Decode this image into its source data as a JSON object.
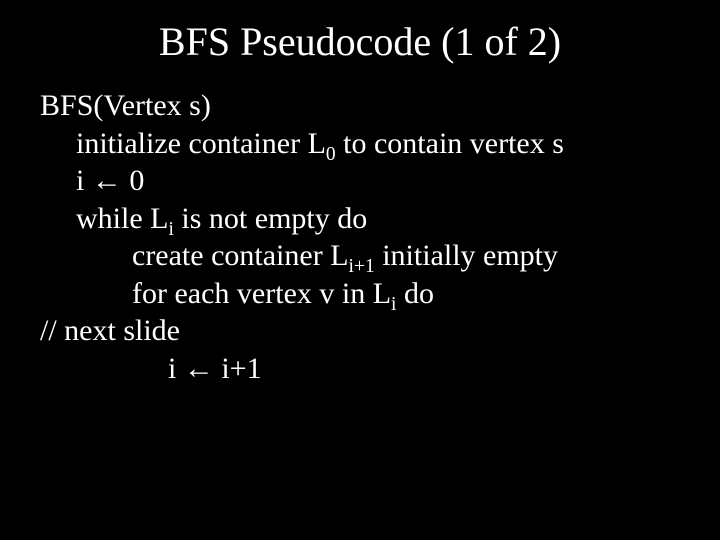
{
  "title": "BFS Pseudocode (1 of 2)",
  "lines": {
    "l0": "BFS(Vertex s)",
    "l1_a": "initialize container L",
    "l1_sub": "0",
    "l1_b": " to contain vertex s",
    "l2_a": "i  ",
    "l2_arrow": "←",
    "l2_b": " 0",
    "l3_a": "while L",
    "l3_sub": "i",
    "l3_b": " is not empty do",
    "l4_a": "create container L",
    "l4_sub": "i+1",
    "l4_b": "  initially empty",
    "l5_a": "for each vertex v in L",
    "l5_sub": "i",
    "l5_b": " do",
    "l6": "// next slide",
    "l7_a": "i ",
    "l7_arrow": "←",
    "l7_b": " i+1"
  }
}
